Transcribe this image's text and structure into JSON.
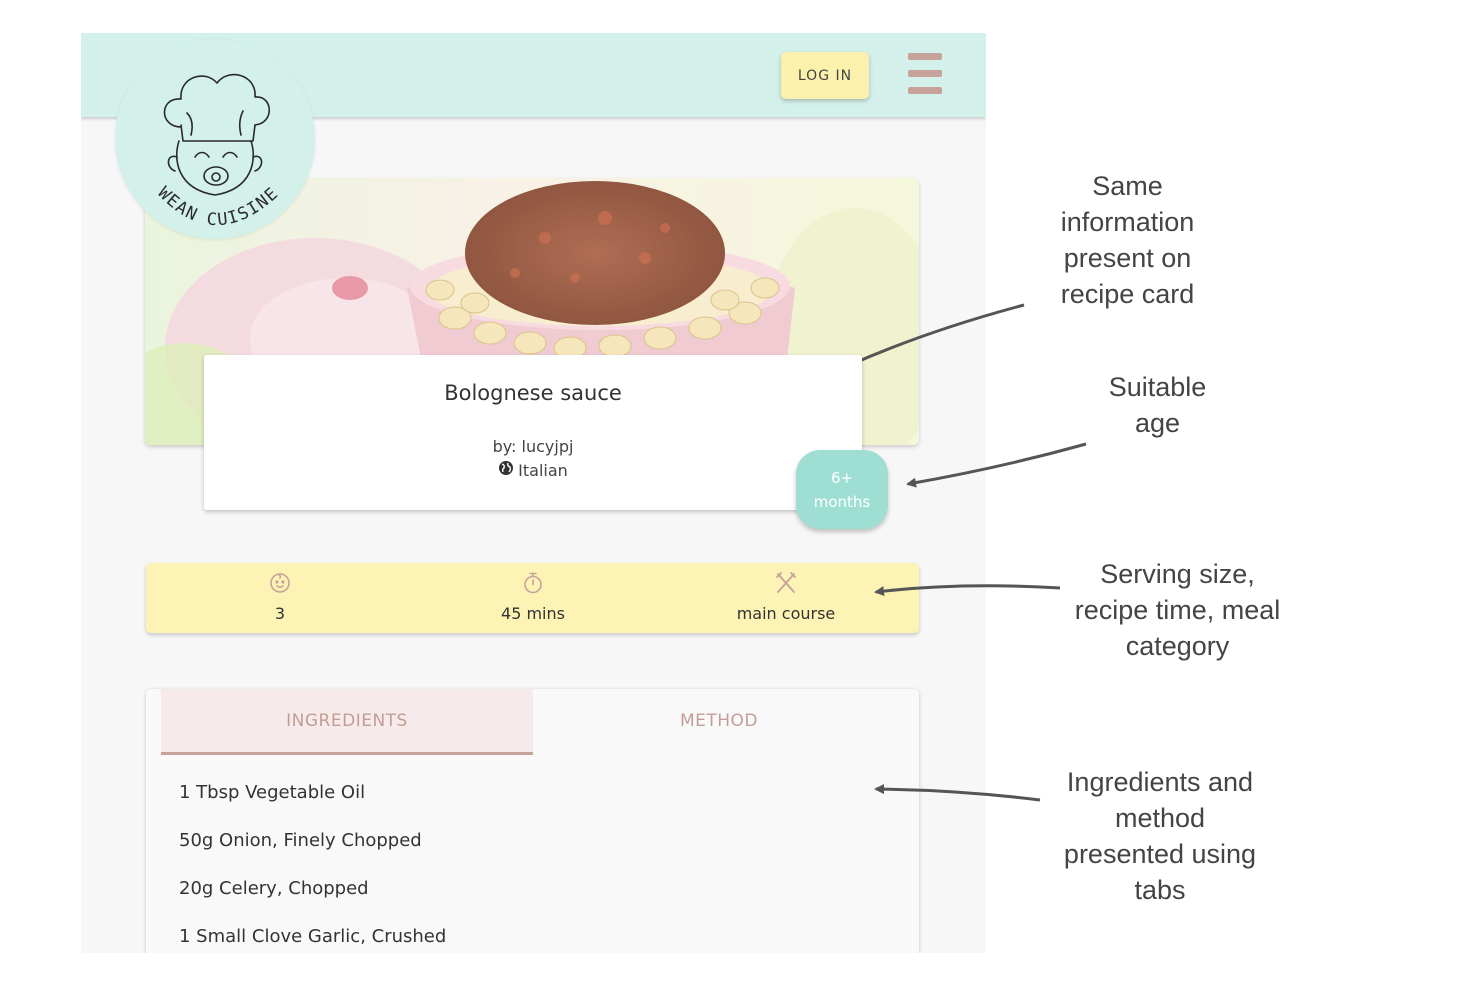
{
  "nav": {
    "login_label": "LOG IN",
    "logo_text": "WEAN CUISINE"
  },
  "recipe": {
    "title": "Bolognese sauce",
    "author": "by: lucyjpj",
    "cuisine": "Italian",
    "age_line1": "6+",
    "age_line2": "months"
  },
  "stats": {
    "servings": "3",
    "time": "45 mins",
    "category": "main course"
  },
  "tabs": [
    {
      "label": "INGREDIENTS"
    },
    {
      "label": "METHOD"
    }
  ],
  "ingredients": [
    "1 Tbsp Vegetable Oil",
    "50g Onion, Finely Chopped",
    "20g Celery, Chopped",
    "1 Small Clove Garlic, Crushed"
  ],
  "annotations": {
    "recipe_card": [
      "Same",
      "information",
      "present on",
      "recipe card"
    ],
    "age": [
      "Suitable",
      "age"
    ],
    "stats": [
      "Serving size,",
      "recipe time, meal",
      "category"
    ],
    "tabs": [
      "Ingredients and",
      "method",
      "presented using",
      "tabs"
    ]
  },
  "colors": {
    "navbar": "#d3f0eb",
    "login_button": "#fcf1ac",
    "hamburger": "#c7a29b",
    "age_badge": "#9fdfd3",
    "stats_bar": "#fcf3b4",
    "tab_accent": "#c7a29b",
    "stat_icon": "#c7a29b"
  },
  "icons": [
    "chef-logo-icon",
    "menu-icon",
    "globe-icon",
    "baby-face-icon",
    "stopwatch-icon",
    "utensils-icon",
    "arrow-icon"
  ]
}
